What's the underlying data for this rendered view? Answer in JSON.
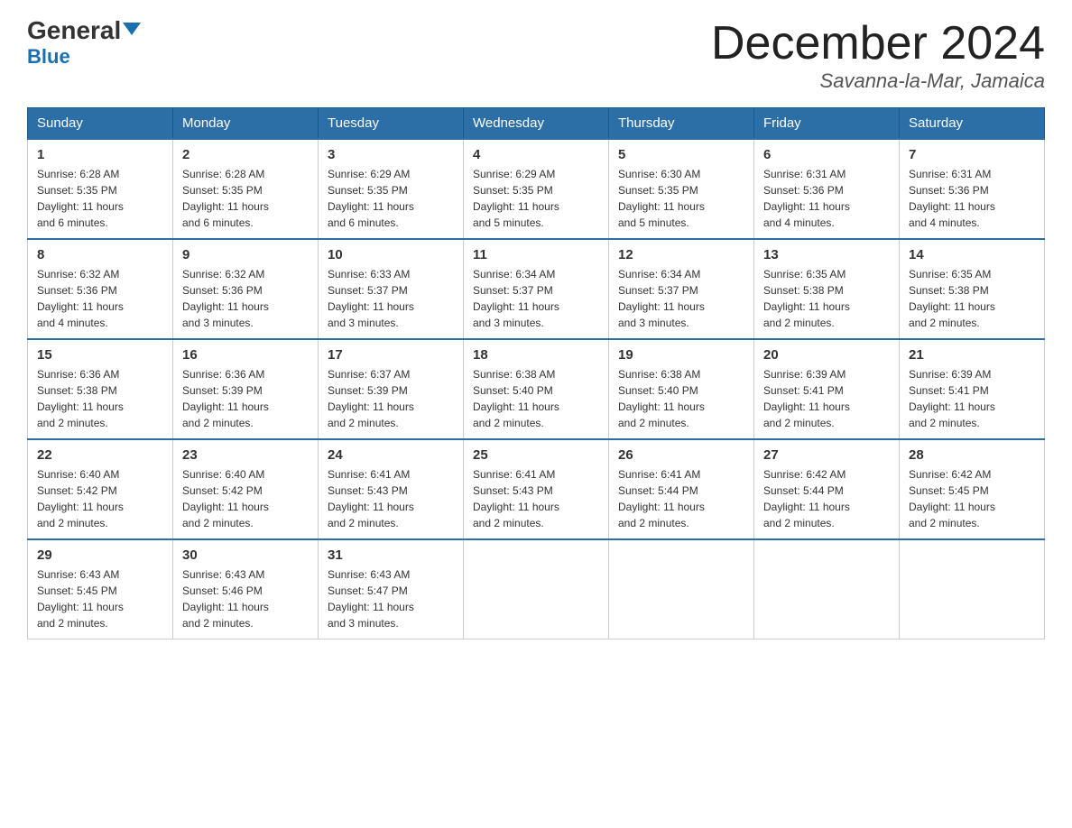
{
  "header": {
    "logo_general": "General",
    "logo_blue": "Blue",
    "month_title": "December 2024",
    "location": "Savanna-la-Mar, Jamaica"
  },
  "days_of_week": [
    "Sunday",
    "Monday",
    "Tuesday",
    "Wednesday",
    "Thursday",
    "Friday",
    "Saturday"
  ],
  "weeks": [
    [
      {
        "day": "1",
        "sunrise": "6:28 AM",
        "sunset": "5:35 PM",
        "daylight": "11 hours and 6 minutes."
      },
      {
        "day": "2",
        "sunrise": "6:28 AM",
        "sunset": "5:35 PM",
        "daylight": "11 hours and 6 minutes."
      },
      {
        "day": "3",
        "sunrise": "6:29 AM",
        "sunset": "5:35 PM",
        "daylight": "11 hours and 6 minutes."
      },
      {
        "day": "4",
        "sunrise": "6:29 AM",
        "sunset": "5:35 PM",
        "daylight": "11 hours and 5 minutes."
      },
      {
        "day": "5",
        "sunrise": "6:30 AM",
        "sunset": "5:35 PM",
        "daylight": "11 hours and 5 minutes."
      },
      {
        "day": "6",
        "sunrise": "6:31 AM",
        "sunset": "5:36 PM",
        "daylight": "11 hours and 4 minutes."
      },
      {
        "day": "7",
        "sunrise": "6:31 AM",
        "sunset": "5:36 PM",
        "daylight": "11 hours and 4 minutes."
      }
    ],
    [
      {
        "day": "8",
        "sunrise": "6:32 AM",
        "sunset": "5:36 PM",
        "daylight": "11 hours and 4 minutes."
      },
      {
        "day": "9",
        "sunrise": "6:32 AM",
        "sunset": "5:36 PM",
        "daylight": "11 hours and 3 minutes."
      },
      {
        "day": "10",
        "sunrise": "6:33 AM",
        "sunset": "5:37 PM",
        "daylight": "11 hours and 3 minutes."
      },
      {
        "day": "11",
        "sunrise": "6:34 AM",
        "sunset": "5:37 PM",
        "daylight": "11 hours and 3 minutes."
      },
      {
        "day": "12",
        "sunrise": "6:34 AM",
        "sunset": "5:37 PM",
        "daylight": "11 hours and 3 minutes."
      },
      {
        "day": "13",
        "sunrise": "6:35 AM",
        "sunset": "5:38 PM",
        "daylight": "11 hours and 2 minutes."
      },
      {
        "day": "14",
        "sunrise": "6:35 AM",
        "sunset": "5:38 PM",
        "daylight": "11 hours and 2 minutes."
      }
    ],
    [
      {
        "day": "15",
        "sunrise": "6:36 AM",
        "sunset": "5:38 PM",
        "daylight": "11 hours and 2 minutes."
      },
      {
        "day": "16",
        "sunrise": "6:36 AM",
        "sunset": "5:39 PM",
        "daylight": "11 hours and 2 minutes."
      },
      {
        "day": "17",
        "sunrise": "6:37 AM",
        "sunset": "5:39 PM",
        "daylight": "11 hours and 2 minutes."
      },
      {
        "day": "18",
        "sunrise": "6:38 AM",
        "sunset": "5:40 PM",
        "daylight": "11 hours and 2 minutes."
      },
      {
        "day": "19",
        "sunrise": "6:38 AM",
        "sunset": "5:40 PM",
        "daylight": "11 hours and 2 minutes."
      },
      {
        "day": "20",
        "sunrise": "6:39 AM",
        "sunset": "5:41 PM",
        "daylight": "11 hours and 2 minutes."
      },
      {
        "day": "21",
        "sunrise": "6:39 AM",
        "sunset": "5:41 PM",
        "daylight": "11 hours and 2 minutes."
      }
    ],
    [
      {
        "day": "22",
        "sunrise": "6:40 AM",
        "sunset": "5:42 PM",
        "daylight": "11 hours and 2 minutes."
      },
      {
        "day": "23",
        "sunrise": "6:40 AM",
        "sunset": "5:42 PM",
        "daylight": "11 hours and 2 minutes."
      },
      {
        "day": "24",
        "sunrise": "6:41 AM",
        "sunset": "5:43 PM",
        "daylight": "11 hours and 2 minutes."
      },
      {
        "day": "25",
        "sunrise": "6:41 AM",
        "sunset": "5:43 PM",
        "daylight": "11 hours and 2 minutes."
      },
      {
        "day": "26",
        "sunrise": "6:41 AM",
        "sunset": "5:44 PM",
        "daylight": "11 hours and 2 minutes."
      },
      {
        "day": "27",
        "sunrise": "6:42 AM",
        "sunset": "5:44 PM",
        "daylight": "11 hours and 2 minutes."
      },
      {
        "day": "28",
        "sunrise": "6:42 AM",
        "sunset": "5:45 PM",
        "daylight": "11 hours and 2 minutes."
      }
    ],
    [
      {
        "day": "29",
        "sunrise": "6:43 AM",
        "sunset": "5:45 PM",
        "daylight": "11 hours and 2 minutes."
      },
      {
        "day": "30",
        "sunrise": "6:43 AM",
        "sunset": "5:46 PM",
        "daylight": "11 hours and 2 minutes."
      },
      {
        "day": "31",
        "sunrise": "6:43 AM",
        "sunset": "5:47 PM",
        "daylight": "11 hours and 3 minutes."
      },
      null,
      null,
      null,
      null
    ]
  ],
  "labels": {
    "sunrise": "Sunrise:",
    "sunset": "Sunset:",
    "daylight": "Daylight:"
  }
}
